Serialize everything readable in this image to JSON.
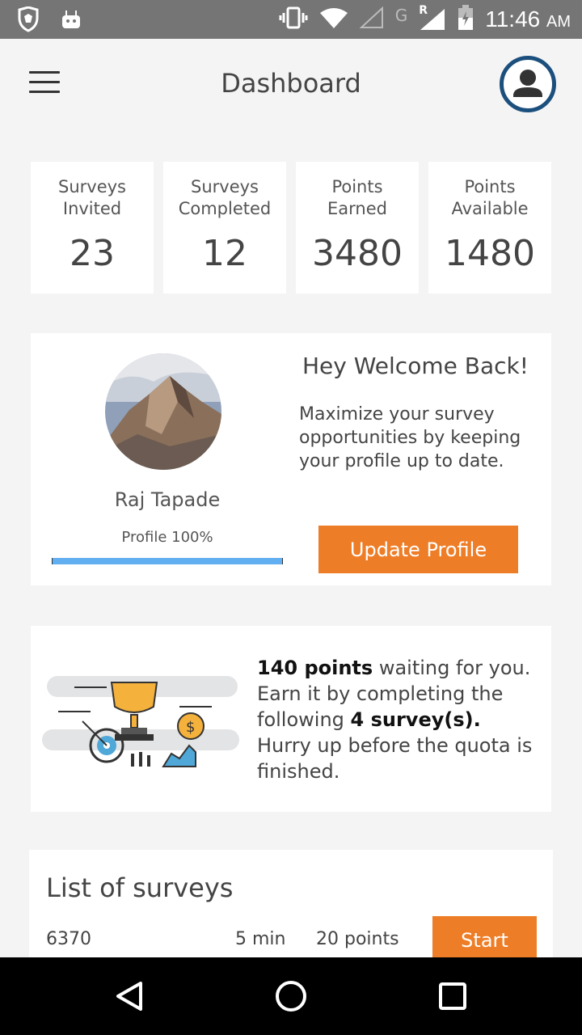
{
  "status_bar": {
    "time": "11:46",
    "ampm": "AM",
    "network": "G",
    "roaming": "R"
  },
  "header": {
    "title": "Dashboard"
  },
  "stats": [
    {
      "label_line1": "Surveys",
      "label_line2": "Invited",
      "value": "23"
    },
    {
      "label_line1": "Surveys",
      "label_line2": "Completed",
      "value": "12"
    },
    {
      "label_line1": "Points",
      "label_line2": "Earned",
      "value": "3480"
    },
    {
      "label_line1": "Points",
      "label_line2": "Available",
      "value": "1480"
    }
  ],
  "profile": {
    "name": "Raj Tapade",
    "completion_label": "Profile 100%",
    "completion_fraction": 1.0,
    "welcome_title": "Hey Welcome Back!",
    "welcome_text": "Maximize your survey opportunities by keeping your profile up to date.",
    "update_button": "Update Profile"
  },
  "points_card": {
    "points_bold": "140 points",
    "text_1": " waiting for you. Earn it by completing the following ",
    "surveys_bold": "4 survey(s).",
    "text_2": " Hurry up before the quota is finished."
  },
  "survey_list": {
    "title": "List of surveys",
    "rows": [
      {
        "id": "6370",
        "duration": "5 min",
        "points": "20 points",
        "action": "Start"
      }
    ]
  },
  "colors": {
    "accent": "#ee7d27",
    "avatar_ring": "#1b4f7d",
    "progress": "#61aef0",
    "status_bar": "#757575"
  },
  "icons": [
    "shield-app-icon",
    "android-icon",
    "vibrate-icon",
    "wifi-icon",
    "signal-icon",
    "battery-icon",
    "menu-icon",
    "account-icon",
    "back-icon",
    "home-icon",
    "recents-icon"
  ]
}
